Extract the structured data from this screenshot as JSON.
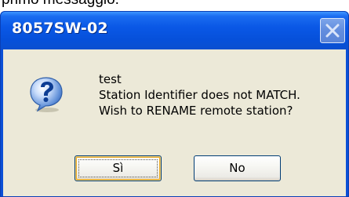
{
  "page": {
    "caption": "primo messaggio:"
  },
  "window": {
    "title": "8057SW-02",
    "close_icon": "close-icon"
  },
  "message": {
    "icon": "question-icon",
    "lines": [
      "test",
      "Station Identifier does not MATCH.",
      "Wish to RENAME remote station?"
    ]
  },
  "buttons": {
    "yes_label": "Sì",
    "no_label": "No"
  },
  "colors": {
    "titlebar": "#0a58e6",
    "client_background": "#ece9d8",
    "button_border": "#003c74",
    "default_button_highlight": "#e5a626"
  }
}
